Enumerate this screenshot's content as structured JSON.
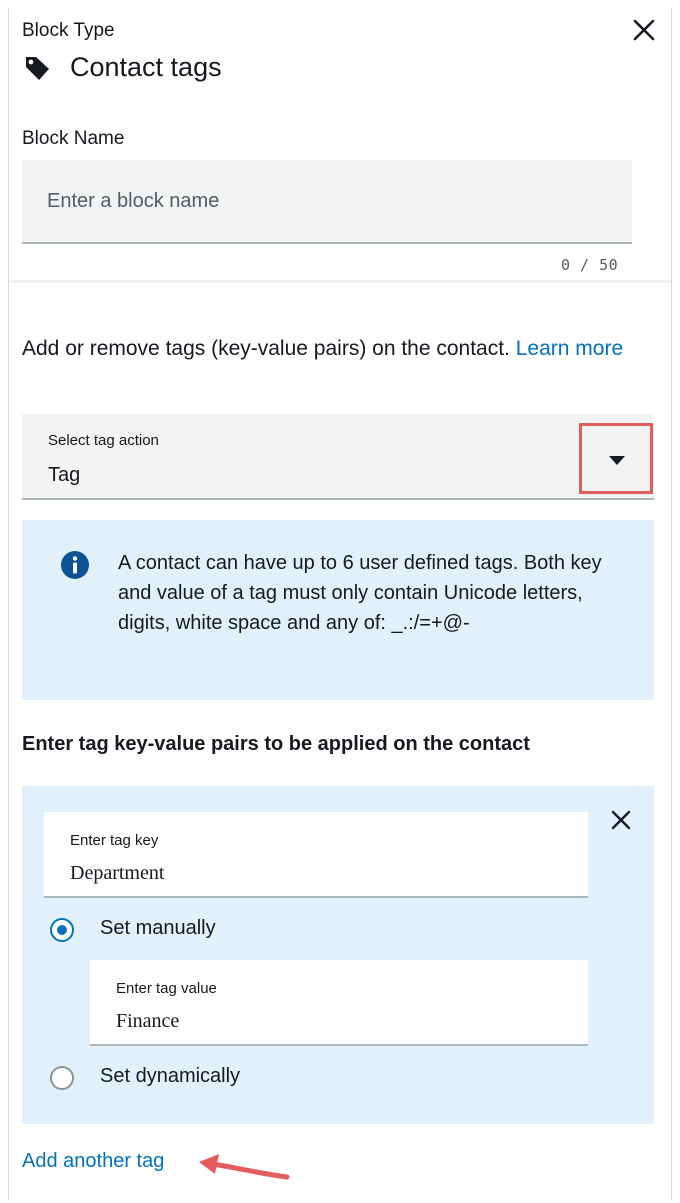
{
  "header": {
    "block_type_label": "Block Type",
    "block_title": "Contact tags",
    "icons": {
      "tag": "tag-icon",
      "close": "close-icon"
    }
  },
  "block_name": {
    "label": "Block Name",
    "placeholder": "Enter a block name",
    "value": "",
    "char_count": "0 / 50"
  },
  "description": {
    "text": "Add or remove tags (key-value pairs) on the contact. ",
    "link_text": "Learn more"
  },
  "tag_action_select": {
    "label": "Select tag action",
    "selected_value": "Tag",
    "icon": "caret-down-icon"
  },
  "info_alert": {
    "icon": "info-icon",
    "text": "A contact can have up to 6 user defined tags. Both key and value of a tag must only contain Unicode letters, digits, white space and any of: _.:/=+@-"
  },
  "tags_section": {
    "heading": "Enter tag key-value pairs to be applied on the contact",
    "tags": [
      {
        "key_label": "Enter tag key",
        "key_value": "Department",
        "radio_manual_label": "Set manually",
        "radio_dynamic_label": "Set dynamically",
        "selected_mode": "manual",
        "value_label": "Enter tag value",
        "value_value": "Finance"
      }
    ],
    "add_another_label": "Add another tag"
  },
  "colors": {
    "accent": "#0073bb",
    "info_background": "#e1f0fb",
    "input_background": "#f2f3f3",
    "annotation_red": "#e35d5d"
  }
}
